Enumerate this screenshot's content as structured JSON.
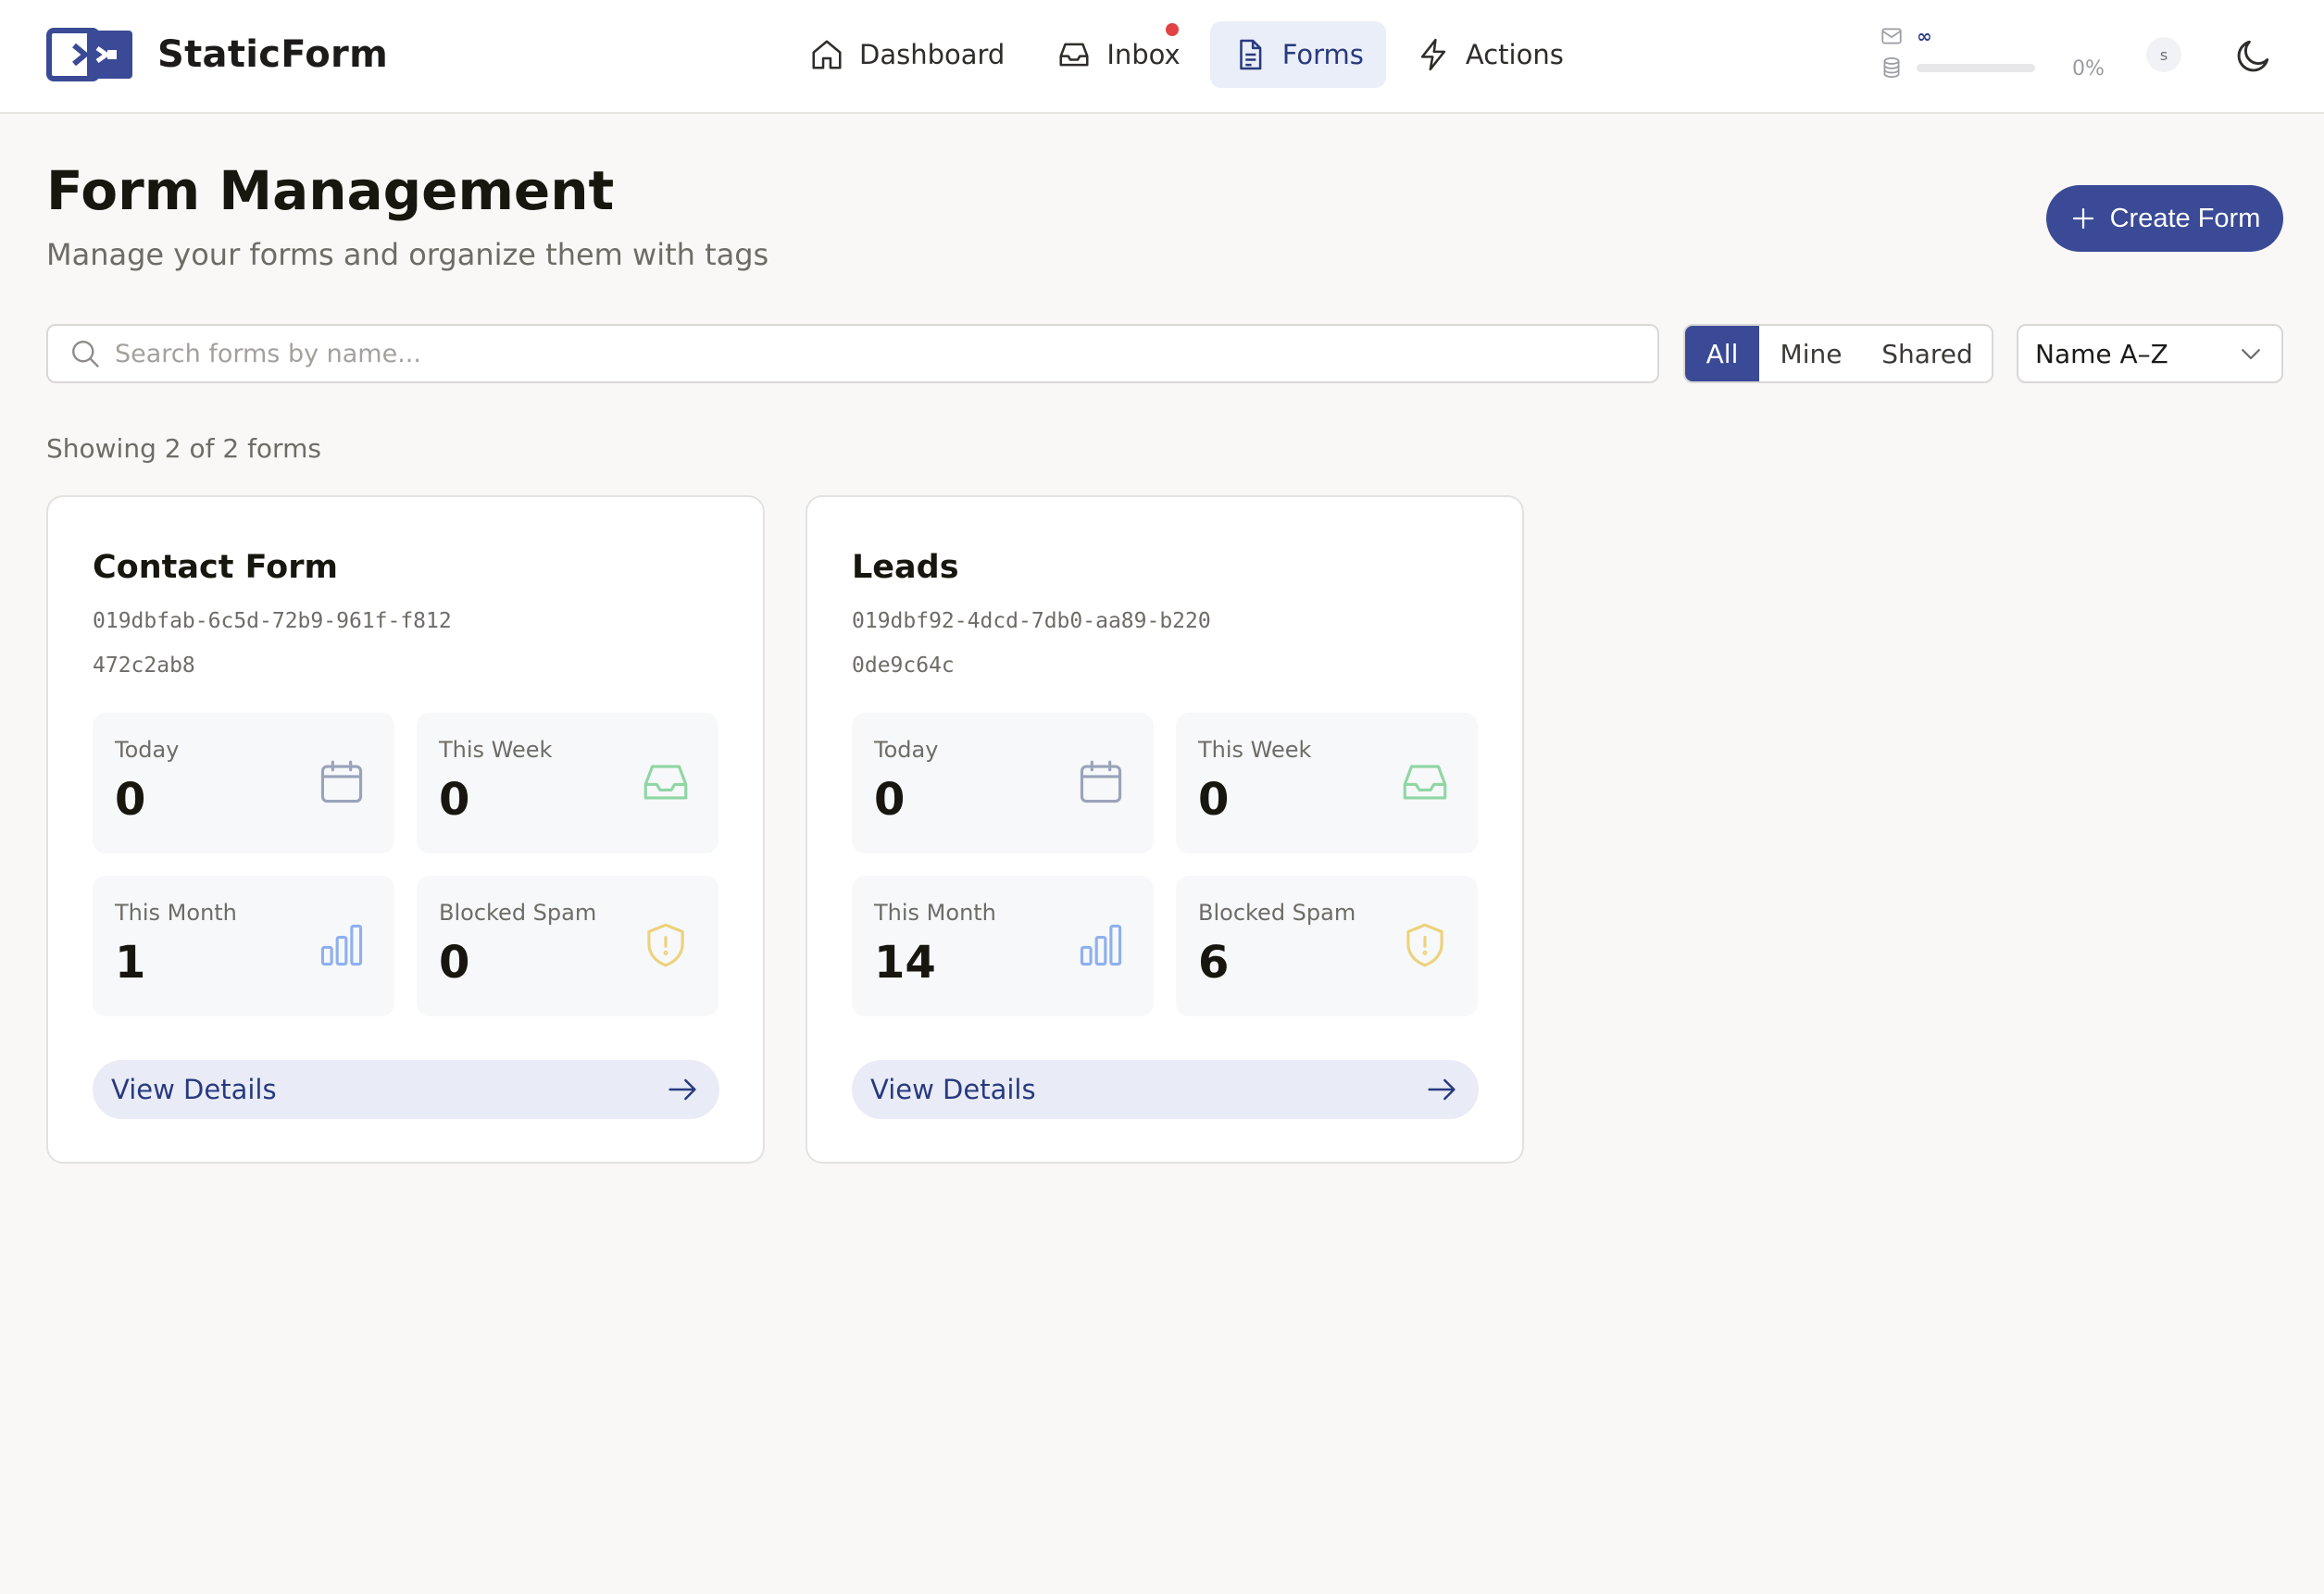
{
  "brand": {
    "name": "StaticForm"
  },
  "nav": {
    "items": [
      {
        "label": "Dashboard",
        "icon": "home-icon"
      },
      {
        "label": "Inbox",
        "icon": "inbox-icon",
        "has_notification": true
      },
      {
        "label": "Forms",
        "icon": "file-icon",
        "active": true
      },
      {
        "label": "Actions",
        "icon": "lightning-icon"
      }
    ]
  },
  "usage": {
    "submissions_limit": "∞",
    "storage_percent_text": "0%",
    "storage_fraction": 0.0
  },
  "user": {
    "avatar_initial": "s"
  },
  "page": {
    "title": "Form Management",
    "subtitle": "Manage your forms and organize them with tags",
    "create_label": "Create Form"
  },
  "filters": {
    "search_placeholder": "Search forms by name...",
    "scope": {
      "all": "All",
      "mine": "Mine",
      "shared": "Shared",
      "selected": "All"
    },
    "sort_value": "Name A–Z"
  },
  "results": {
    "count_text": "Showing 2 of 2 forms"
  },
  "forms": [
    {
      "name": "Contact Form",
      "id": "019dbfab-6c5d-72b9-961f-f812472c2ab8",
      "stats": {
        "today": {
          "label": "Today",
          "value": "0"
        },
        "week": {
          "label": "This Week",
          "value": "0"
        },
        "month": {
          "label": "This Month",
          "value": "1"
        },
        "spam": {
          "label": "Blocked Spam",
          "value": "0"
        }
      },
      "view_label": "View Details"
    },
    {
      "name": "Leads",
      "id": "019dbf92-4dcd-7db0-aa89-b2200de9c64c",
      "stats": {
        "today": {
          "label": "Today",
          "value": "0"
        },
        "week": {
          "label": "This Week",
          "value": "0"
        },
        "month": {
          "label": "This Month",
          "value": "14"
        },
        "spam": {
          "label": "Blocked Spam",
          "value": "6"
        }
      },
      "view_label": "View Details"
    }
  ],
  "colors": {
    "brand_primary": "#3a4a96",
    "calendar_icon": "#9aa3ba",
    "inbox_icon": "#8fd6a4",
    "chart_icon": "#8fb0ee",
    "shield_icon": "#ecd27c"
  }
}
